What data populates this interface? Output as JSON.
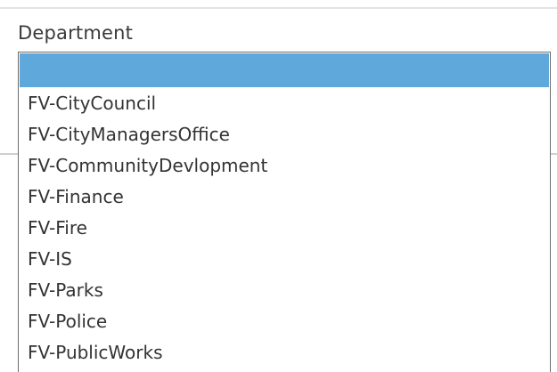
{
  "field": {
    "label": "Department"
  },
  "dropdown": {
    "selected_index": 0,
    "highlight_color": "#5fa8dc",
    "options": [
      "",
      "FV-CityCouncil",
      "FV-CityManagersOffice",
      "FV-CommunityDevlopment",
      "FV-Finance",
      "FV-Fire",
      "FV-IS",
      "FV-Parks",
      "FV-Police",
      "FV-PublicWorks"
    ]
  }
}
